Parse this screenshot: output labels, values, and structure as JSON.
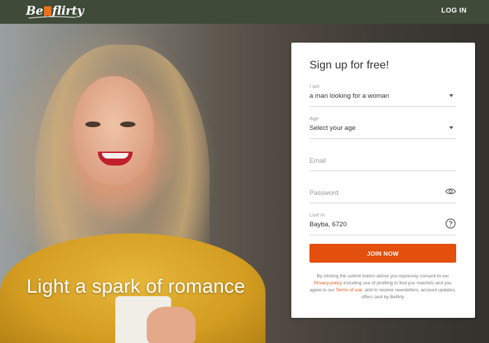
{
  "brand": {
    "logo_left": "Be",
    "logo_right": "flirty",
    "accent": "#e34f0c"
  },
  "header": {
    "login_label": "LOG IN"
  },
  "hero": {
    "tagline": "Light a spark of romance"
  },
  "form": {
    "title": "Sign up for free!",
    "iam": {
      "label": "I am",
      "value": "a man looking for a woman",
      "icon": "chevron-down-icon"
    },
    "age": {
      "label": "Age",
      "value": "Select your age",
      "icon": "chevron-down-icon"
    },
    "email": {
      "placeholder": "Email"
    },
    "password": {
      "placeholder": "Password",
      "icon": "eye-icon"
    },
    "location": {
      "label": "Live in",
      "value": "Bayba, 6720",
      "icon": "help-circle-icon"
    },
    "submit_label": "JOIN NOW",
    "consent": {
      "part1": "By clicking the submit button above you expressly consent to our ",
      "privacy_link": "Privacy policy",
      "part2": " including use of profiling to find you matches and you agree to our ",
      "terms_link": "Terms of use",
      "part3": ", and to receive newsletters, account updates, offers sent by Beflirty"
    }
  }
}
